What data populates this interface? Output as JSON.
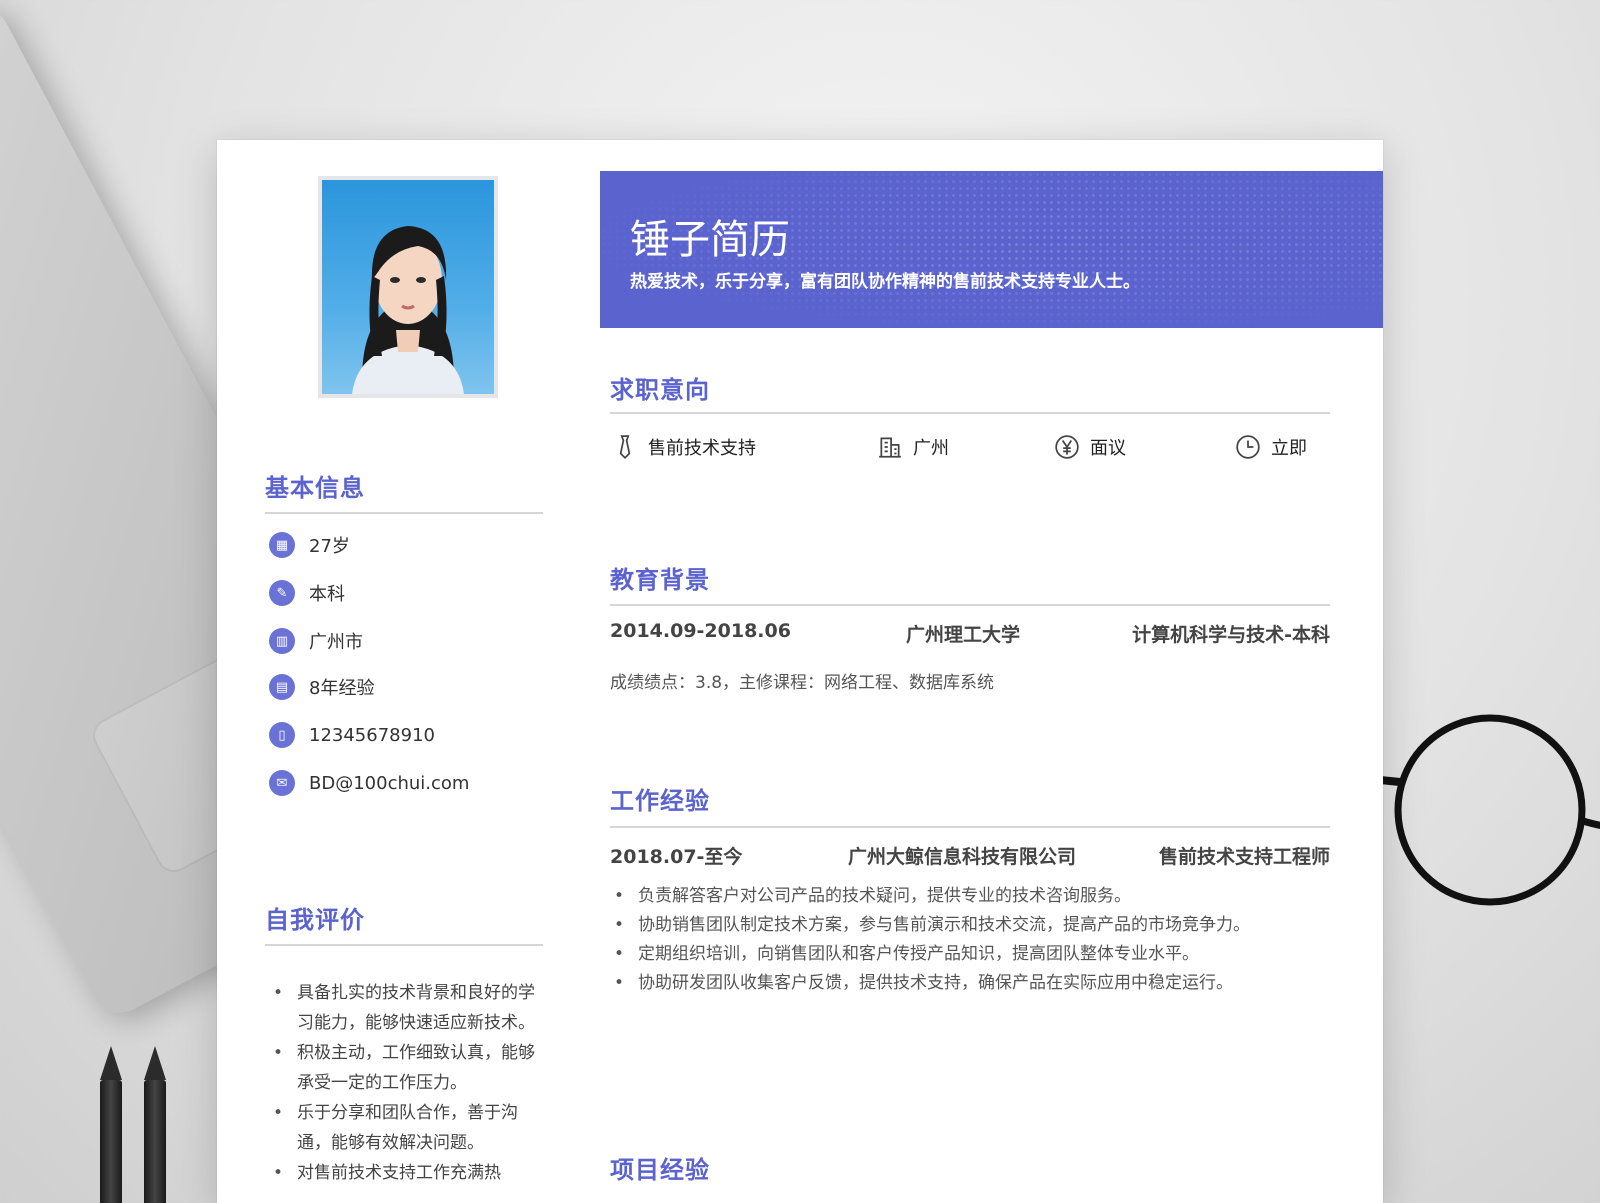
{
  "resume": {
    "title": "锤子简历",
    "tagline": "热爱技术，乐于分享，富有团队协作精神的售前技术支持专业人士。"
  },
  "basic_info": {
    "heading": "基本信息",
    "age": "27岁",
    "education": "本科",
    "city": "广州市",
    "experience": "8年经验",
    "phone": "12345678910",
    "email": "BD@100chui.com"
  },
  "self_eval": {
    "heading": "自我评价",
    "items": [
      "具备扎实的技术背景和良好的学习能力，能够快速适应新技术。",
      "积极主动，工作细致认真，能够承受一定的工作压力。",
      "乐于分享和团队合作，善于沟通，能够有效解决问题。",
      "对售前技术支持工作充满热"
    ]
  },
  "job_intent": {
    "heading": "求职意向",
    "position": "售前技术支持",
    "location": "广州",
    "salary": "面议",
    "availability": "立即"
  },
  "education": {
    "heading": "教育背景",
    "period": "2014.09-2018.06",
    "school": "广州理工大学",
    "major": "计算机科学与技术-本科",
    "note": "成绩绩点：3.8，主修课程：网络工程、数据库系统"
  },
  "work": {
    "heading": "工作经验",
    "period": "2018.07-至今",
    "company": "广州大鲸信息科技有限公司",
    "role": "售前技术支持工程师",
    "items": [
      "负责解答客户对公司产品的技术疑问，提供专业的技术咨询服务。",
      "协助销售团队制定技术方案，参与售前演示和技术交流，提高产品的市场竞争力。",
      "定期组织培训，向销售团队和客户传授产品知识，提高团队整体专业水平。",
      "协助研发团队收集客户反馈，提供技术支持，确保产品在实际应用中稳定运行。"
    ]
  },
  "projects": {
    "heading": "项目经验"
  },
  "colors": {
    "accent": "#5b63cf",
    "rule": "#d6d6d6"
  }
}
